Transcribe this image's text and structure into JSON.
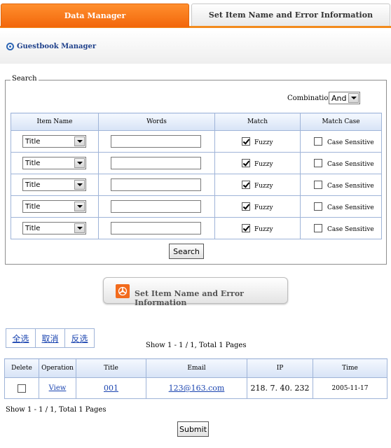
{
  "tabs": [
    {
      "label": "Data Manager",
      "active": true
    },
    {
      "label": "Set Item Name and Error Information",
      "active": false
    }
  ],
  "subheader": {
    "title": "Guestbook Manager"
  },
  "search": {
    "legend": "Search",
    "combination_label": "Combination:",
    "combination_value": "And",
    "headers": [
      "Item Name",
      "Words",
      "Match",
      "Match Case"
    ],
    "rows": [
      {
        "item": "Title",
        "words": "",
        "fuzzy": true,
        "fuzzy_label": "Fuzzy",
        "case": false,
        "case_label": "Case Sensitive"
      },
      {
        "item": "Title",
        "words": "",
        "fuzzy": true,
        "fuzzy_label": "Fuzzy",
        "case": false,
        "case_label": "Case Sensitive"
      },
      {
        "item": "Title",
        "words": "",
        "fuzzy": true,
        "fuzzy_label": "Fuzzy",
        "case": false,
        "case_label": "Case Sensitive"
      },
      {
        "item": "Title",
        "words": "",
        "fuzzy": true,
        "fuzzy_label": "Fuzzy",
        "case": false,
        "case_label": "Case Sensitive"
      },
      {
        "item": "Title",
        "words": "",
        "fuzzy": true,
        "fuzzy_label": "Fuzzy",
        "case": false,
        "case_label": "Case Sensitive"
      }
    ],
    "button_label": "Search"
  },
  "set_item_button": {
    "label": "Set Item Name and Error Information"
  },
  "selection": {
    "select_all": "全选",
    "cancel": "取消",
    "invert": "反选"
  },
  "pager": {
    "text": "Show 1 - 1 / 1, Total 1 Pages"
  },
  "results": {
    "headers": [
      "Delete",
      "Operation",
      "Title",
      "Email",
      "IP",
      "Time"
    ],
    "rows": [
      {
        "delete": false,
        "operation": "View",
        "title": "001",
        "email": "123@163.com",
        "ip": "218. 7. 40. 232",
        "time": "2005-11-17"
      }
    ]
  },
  "submit_label": "Submit",
  "colors": {
    "accent": "#f2660a",
    "header_blue": "#d7e3f6",
    "link": "#1a44b0"
  }
}
